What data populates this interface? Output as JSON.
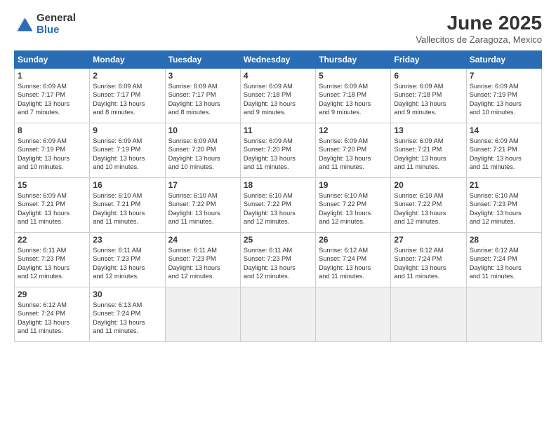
{
  "logo": {
    "general": "General",
    "blue": "Blue"
  },
  "title": "June 2025",
  "subtitle": "Vallecitos de Zaragoza, Mexico",
  "days_header": [
    "Sunday",
    "Monday",
    "Tuesday",
    "Wednesday",
    "Thursday",
    "Friday",
    "Saturday"
  ],
  "weeks": [
    [
      {
        "day": "1",
        "lines": [
          "Sunrise: 6:09 AM",
          "Sunset: 7:17 PM",
          "Daylight: 13 hours",
          "and 7 minutes."
        ]
      },
      {
        "day": "2",
        "lines": [
          "Sunrise: 6:09 AM",
          "Sunset: 7:17 PM",
          "Daylight: 13 hours",
          "and 8 minutes."
        ]
      },
      {
        "day": "3",
        "lines": [
          "Sunrise: 6:09 AM",
          "Sunset: 7:17 PM",
          "Daylight: 13 hours",
          "and 8 minutes."
        ]
      },
      {
        "day": "4",
        "lines": [
          "Sunrise: 6:09 AM",
          "Sunset: 7:18 PM",
          "Daylight: 13 hours",
          "and 9 minutes."
        ]
      },
      {
        "day": "5",
        "lines": [
          "Sunrise: 6:09 AM",
          "Sunset: 7:18 PM",
          "Daylight: 13 hours",
          "and 9 minutes."
        ]
      },
      {
        "day": "6",
        "lines": [
          "Sunrise: 6:09 AM",
          "Sunset: 7:18 PM",
          "Daylight: 13 hours",
          "and 9 minutes."
        ]
      },
      {
        "day": "7",
        "lines": [
          "Sunrise: 6:09 AM",
          "Sunset: 7:19 PM",
          "Daylight: 13 hours",
          "and 10 minutes."
        ]
      }
    ],
    [
      {
        "day": "8",
        "lines": [
          "Sunrise: 6:09 AM",
          "Sunset: 7:19 PM",
          "Daylight: 13 hours",
          "and 10 minutes."
        ]
      },
      {
        "day": "9",
        "lines": [
          "Sunrise: 6:09 AM",
          "Sunset: 7:19 PM",
          "Daylight: 13 hours",
          "and 10 minutes."
        ]
      },
      {
        "day": "10",
        "lines": [
          "Sunrise: 6:09 AM",
          "Sunset: 7:20 PM",
          "Daylight: 13 hours",
          "and 10 minutes."
        ]
      },
      {
        "day": "11",
        "lines": [
          "Sunrise: 6:09 AM",
          "Sunset: 7:20 PM",
          "Daylight: 13 hours",
          "and 11 minutes."
        ]
      },
      {
        "day": "12",
        "lines": [
          "Sunrise: 6:09 AM",
          "Sunset: 7:20 PM",
          "Daylight: 13 hours",
          "and 11 minutes."
        ]
      },
      {
        "day": "13",
        "lines": [
          "Sunrise: 6:09 AM",
          "Sunset: 7:21 PM",
          "Daylight: 13 hours",
          "and 11 minutes."
        ]
      },
      {
        "day": "14",
        "lines": [
          "Sunrise: 6:09 AM",
          "Sunset: 7:21 PM",
          "Daylight: 13 hours",
          "and 11 minutes."
        ]
      }
    ],
    [
      {
        "day": "15",
        "lines": [
          "Sunrise: 6:09 AM",
          "Sunset: 7:21 PM",
          "Daylight: 13 hours",
          "and 11 minutes."
        ]
      },
      {
        "day": "16",
        "lines": [
          "Sunrise: 6:10 AM",
          "Sunset: 7:21 PM",
          "Daylight: 13 hours",
          "and 11 minutes."
        ]
      },
      {
        "day": "17",
        "lines": [
          "Sunrise: 6:10 AM",
          "Sunset: 7:22 PM",
          "Daylight: 13 hours",
          "and 11 minutes."
        ]
      },
      {
        "day": "18",
        "lines": [
          "Sunrise: 6:10 AM",
          "Sunset: 7:22 PM",
          "Daylight: 13 hours",
          "and 12 minutes."
        ]
      },
      {
        "day": "19",
        "lines": [
          "Sunrise: 6:10 AM",
          "Sunset: 7:22 PM",
          "Daylight: 13 hours",
          "and 12 minutes."
        ]
      },
      {
        "day": "20",
        "lines": [
          "Sunrise: 6:10 AM",
          "Sunset: 7:22 PM",
          "Daylight: 13 hours",
          "and 12 minutes."
        ]
      },
      {
        "day": "21",
        "lines": [
          "Sunrise: 6:10 AM",
          "Sunset: 7:23 PM",
          "Daylight: 13 hours",
          "and 12 minutes."
        ]
      }
    ],
    [
      {
        "day": "22",
        "lines": [
          "Sunrise: 6:11 AM",
          "Sunset: 7:23 PM",
          "Daylight: 13 hours",
          "and 12 minutes."
        ]
      },
      {
        "day": "23",
        "lines": [
          "Sunrise: 6:11 AM",
          "Sunset: 7:23 PM",
          "Daylight: 13 hours",
          "and 12 minutes."
        ]
      },
      {
        "day": "24",
        "lines": [
          "Sunrise: 6:11 AM",
          "Sunset: 7:23 PM",
          "Daylight: 13 hours",
          "and 12 minutes."
        ]
      },
      {
        "day": "25",
        "lines": [
          "Sunrise: 6:11 AM",
          "Sunset: 7:23 PM",
          "Daylight: 13 hours",
          "and 12 minutes."
        ]
      },
      {
        "day": "26",
        "lines": [
          "Sunrise: 6:12 AM",
          "Sunset: 7:24 PM",
          "Daylight: 13 hours",
          "and 11 minutes."
        ]
      },
      {
        "day": "27",
        "lines": [
          "Sunrise: 6:12 AM",
          "Sunset: 7:24 PM",
          "Daylight: 13 hours",
          "and 11 minutes."
        ]
      },
      {
        "day": "28",
        "lines": [
          "Sunrise: 6:12 AM",
          "Sunset: 7:24 PM",
          "Daylight: 13 hours",
          "and 11 minutes."
        ]
      }
    ],
    [
      {
        "day": "29",
        "lines": [
          "Sunrise: 6:12 AM",
          "Sunset: 7:24 PM",
          "Daylight: 13 hours",
          "and 11 minutes."
        ]
      },
      {
        "day": "30",
        "lines": [
          "Sunrise: 6:13 AM",
          "Sunset: 7:24 PM",
          "Daylight: 13 hours",
          "and 11 minutes."
        ]
      },
      null,
      null,
      null,
      null,
      null
    ]
  ]
}
